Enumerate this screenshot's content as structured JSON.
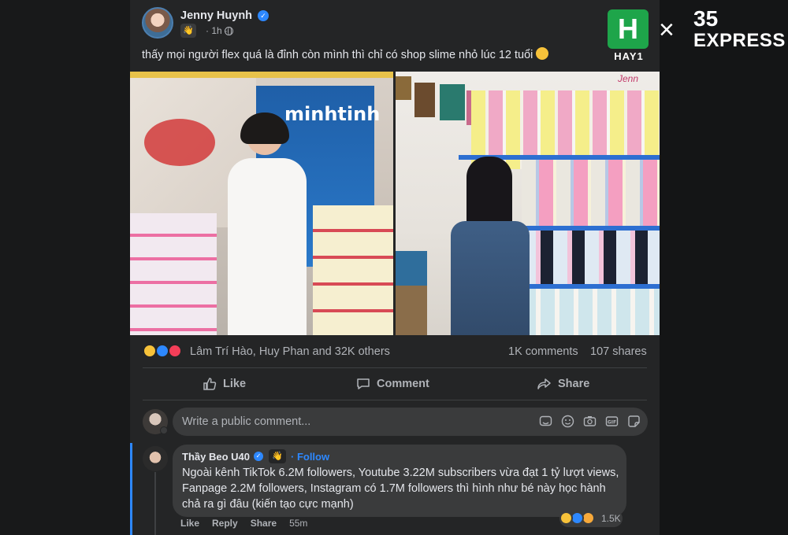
{
  "post": {
    "author": "Jenny Huynh",
    "verified_icon": "verified-badge-icon",
    "time": "1h",
    "audience_icon": "globe-icon",
    "text": "thấy mọi người flex quá là đỉnh còn mình thì chỉ có shop slime nhỏ lúc 12 tuổi",
    "photos": [
      {
        "name": "photo-shop-left",
        "sign_text": "minhtinh"
      },
      {
        "name": "photo-shop-right",
        "sign_text": "Jenn"
      }
    ]
  },
  "stats": {
    "reaction_names": "Lâm Trí Hào, Huy Phan and 32K others",
    "comments": "1K comments",
    "shares": "107 shares",
    "reaction_icons": [
      "haha-icon",
      "like-icon",
      "love-icon"
    ]
  },
  "actions": {
    "like": "Like",
    "comment": "Comment",
    "share": "Share"
  },
  "composer": {
    "placeholder": "Write a public comment...",
    "icons": [
      "sticker-emoji-icon",
      "emoji-icon",
      "camera-icon",
      "gif-icon",
      "sticker-icon"
    ]
  },
  "comment": {
    "author": "Thầy Beo U40",
    "follow": "· Follow",
    "text": "Ngoài kênh TikTok 6.2M followers, Youtube 3.22M subscribers vừa đạt 1 tỷ lượt views, Fanpage 2.2M followers, Instagram có 1.7M followers thì hình như bé này học hành chả ra gì đâu (kiến tạo cực mạnh)",
    "like": "Like",
    "reply": "Reply",
    "share": "Share",
    "time": "55m",
    "reaction_count": "1.5K"
  },
  "brand": {
    "logo_letter": "H",
    "logo_label": "HAY1",
    "times": "×",
    "partner_number": "35",
    "partner_word": "EXPRESS"
  },
  "colors": {
    "accent": "#2d88ff",
    "card_bg": "#242526",
    "page_bg": "#18191a",
    "brand_green": "#1ea54a"
  }
}
